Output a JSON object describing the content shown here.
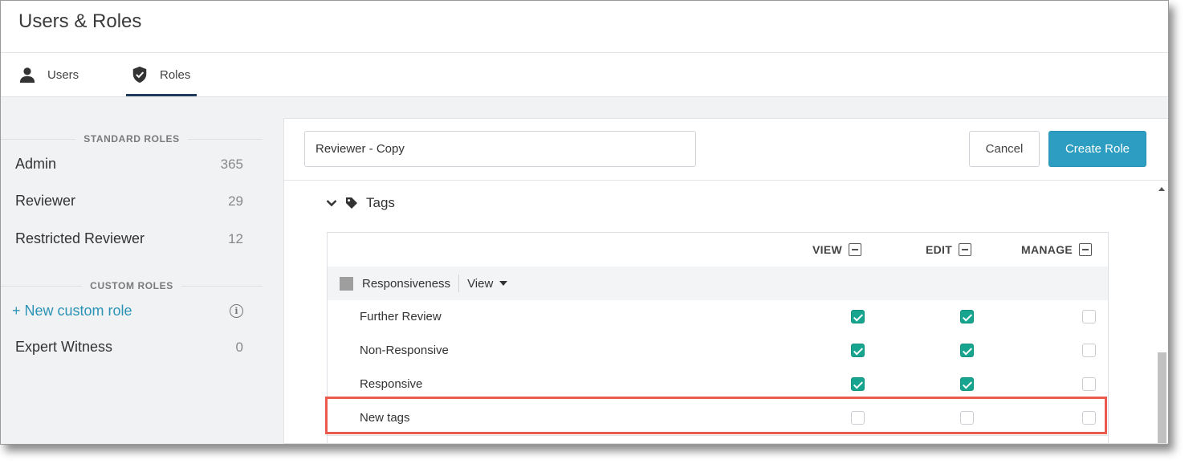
{
  "app": {
    "title": "Users & Roles"
  },
  "tabs": [
    {
      "label": "Users",
      "icon": "person-icon",
      "active": false
    },
    {
      "label": "Roles",
      "icon": "shield-icon",
      "active": true
    }
  ],
  "sidebar": {
    "standard_heading": "STANDARD ROLES",
    "standard_roles": [
      {
        "name": "Admin",
        "count": "365"
      },
      {
        "name": "Reviewer",
        "count": "29"
      },
      {
        "name": "Restricted Reviewer",
        "count": "12"
      }
    ],
    "custom_heading": "CUSTOM ROLES",
    "new_custom_label": "+ New custom role",
    "custom_roles": [
      {
        "name": "Expert Witness",
        "count": "0"
      }
    ]
  },
  "editor": {
    "role_name_value": "Reviewer - Copy",
    "cancel_label": "Cancel",
    "create_label": "Create Role",
    "section_label": "Tags",
    "columns": [
      "VIEW",
      "EDIT",
      "MANAGE"
    ],
    "group": {
      "name": "Responsiveness",
      "level": "View"
    },
    "rows": [
      {
        "label": "Further Review",
        "view": true,
        "edit": true,
        "manage": false
      },
      {
        "label": "Non-Responsive",
        "view": true,
        "edit": true,
        "manage": false
      },
      {
        "label": "Responsive",
        "view": true,
        "edit": true,
        "manage": false
      },
      {
        "label": "New tags",
        "view": false,
        "edit": false,
        "manage": false
      }
    ]
  },
  "colors": {
    "accent": "#2d9ec2",
    "checkbox_on": "#17a58f",
    "highlight": "#ea5a4f",
    "tab_underline": "#1e3a5c"
  }
}
